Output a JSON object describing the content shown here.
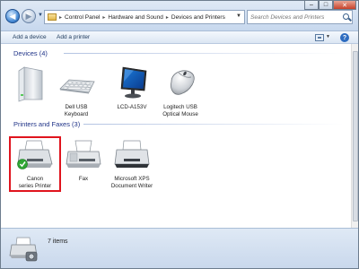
{
  "window": {
    "min_glyph": "–",
    "max_glyph": "□",
    "close_glyph": "✕"
  },
  "address": {
    "crumbs": [
      "Control Panel",
      "Hardware and Sound",
      "Devices and Printers"
    ],
    "separator": "▸"
  },
  "search": {
    "placeholder": "Search Devices and Printers"
  },
  "toolbar": {
    "add_device": "Add a device",
    "add_printer": "Add a printer",
    "help_glyph": "?"
  },
  "groups": {
    "devices": {
      "title": "Devices (4)",
      "items": [
        {
          "label_line1": "",
          "label_line2": "",
          "icon": "computer-tower-icon"
        },
        {
          "label_line1": "Dell USB",
          "label_line2": "Keyboard",
          "icon": "keyboard-icon"
        },
        {
          "label_line1": "LCD-A153V",
          "label_line2": "",
          "icon": "monitor-icon"
        },
        {
          "label_line1": "Logitech USB",
          "label_line2": "Optical Mouse",
          "icon": "mouse-icon"
        }
      ]
    },
    "printers": {
      "title": "Printers and Faxes (3)",
      "items": [
        {
          "label_line1": "Canon",
          "label_line2": "series Printer",
          "icon": "printer-default-icon"
        },
        {
          "label_line1": "Fax",
          "label_line2": "",
          "icon": "fax-icon"
        },
        {
          "label_line1": "Microsoft XPS",
          "label_line2": "Document Writer",
          "icon": "xps-printer-icon"
        }
      ]
    }
  },
  "status": {
    "count_text": "7 items"
  },
  "colors": {
    "group_heading": "#1e3287",
    "selection_border": "#e0141e"
  }
}
